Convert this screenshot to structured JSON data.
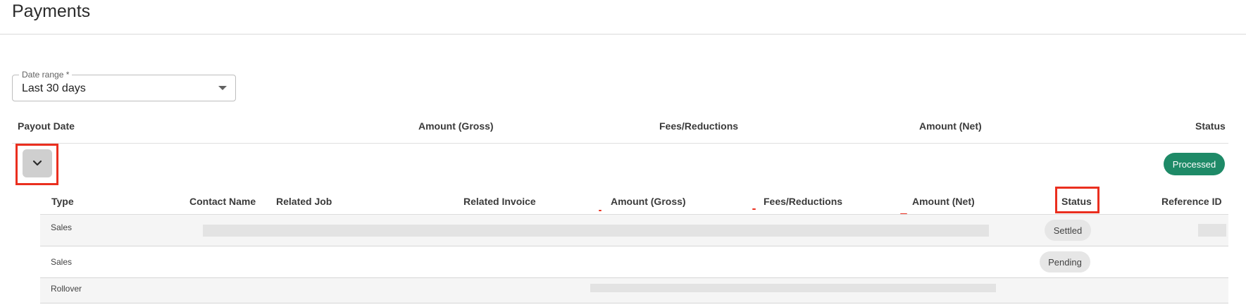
{
  "page": {
    "title": "Payments"
  },
  "filters": {
    "date_range_label": "Date range *",
    "date_range_value": "Last 30 days"
  },
  "payouts_table": {
    "headers": {
      "payout_date": "Payout Date",
      "amount_gross": "Amount (Gross)",
      "fees": "Fees/Reductions",
      "amount_net": "Amount (Net)",
      "status": "Status"
    },
    "rows": [
      {
        "status": "Processed"
      }
    ]
  },
  "transactions_table": {
    "headers": {
      "type": "Type",
      "contact_name": "Contact Name",
      "related_job": "Related Job",
      "related_invoice": "Related Invoice",
      "amount_gross": "Amount (Gross)",
      "fees": "Fees/Reductions",
      "amount_net": "Amount (Net)",
      "status": "Status",
      "reference_id": "Reference ID"
    },
    "rows": [
      {
        "type": "Sales",
        "status": "Settled"
      },
      {
        "type": "Sales",
        "status": "Pending"
      },
      {
        "type": "Rollover",
        "status": ""
      }
    ]
  },
  "colors": {
    "processed_badge": "#1e8a67",
    "highlight_box": "#ea2f1f",
    "pill_bg": "#e6e6e6"
  },
  "icons": {
    "expand": "chevron-down-icon",
    "dropdown": "caret-down-icon"
  }
}
